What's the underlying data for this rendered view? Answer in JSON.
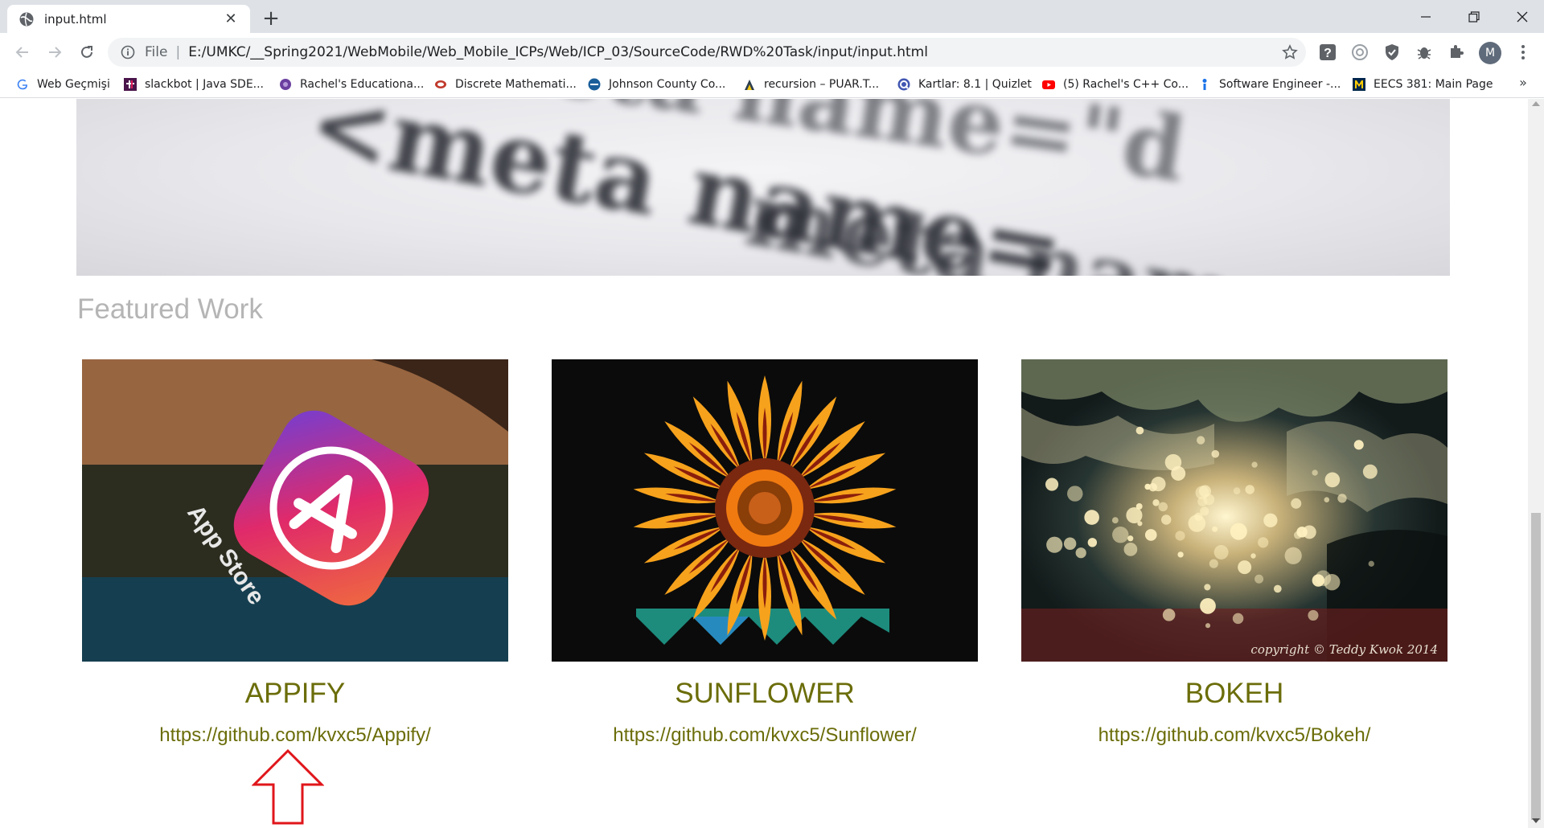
{
  "browser": {
    "tab_title": "input.html",
    "omnibox": {
      "scheme": "File",
      "url": "E:/UMKC/__Spring2021/WebMobile/Web_Mobile_ICPs/Web/ICP_03/SourceCode/RWD%20Task/input/input.html"
    },
    "profile_initial": "M"
  },
  "bookmarks": [
    {
      "label": "Web Geçmişi",
      "icon": "google-icon"
    },
    {
      "label": "slackbot | Java SDE...",
      "icon": "slack-icon"
    },
    {
      "label": "Rachel's Educationa...",
      "icon": "educational-icon"
    },
    {
      "label": "Discrete Mathemati...",
      "icon": "discrete-math-icon"
    },
    {
      "label": "Johnson County Co...",
      "icon": "jccc-icon"
    },
    {
      "label": "recursion – PUAR.T...",
      "icon": "recursion-icon"
    },
    {
      "label": "Kartlar: 8.1 | Quizlet",
      "icon": "quizlet-icon"
    },
    {
      "label": "(5) Rachel's C++ Co...",
      "icon": "youtube-icon"
    },
    {
      "label": "Software Engineer -...",
      "icon": "software-engineer-icon"
    },
    {
      "label": "EECS 381: Main Page",
      "icon": "umich-icon"
    }
  ],
  "hero": {
    "text_lines": [
      "<meta name=\"d",
      "<meta name=",
      "meta nam"
    ]
  },
  "page": {
    "featured_title": "Featured Work",
    "cards": [
      {
        "name": "APPIFY",
        "link": "https://github.com/kvxc5/Appify/",
        "image": "app-store-icon-photo",
        "image_caption": "App Store"
      },
      {
        "name": "SUNFLOWER",
        "link": "https://github.com/kvxc5/Sunflower/",
        "image": "sunflower-photo"
      },
      {
        "name": "BOKEH",
        "link": "https://github.com/kvxc5/Bokeh/",
        "image": "bokeh-photo",
        "watermark": "copyright © Teddy Kwok 2014"
      }
    ]
  },
  "annotation": {
    "arrow_color": "#e0161b"
  },
  "colors": {
    "accent": "#6b6d0a",
    "featured_title": "#b5b5b5"
  }
}
